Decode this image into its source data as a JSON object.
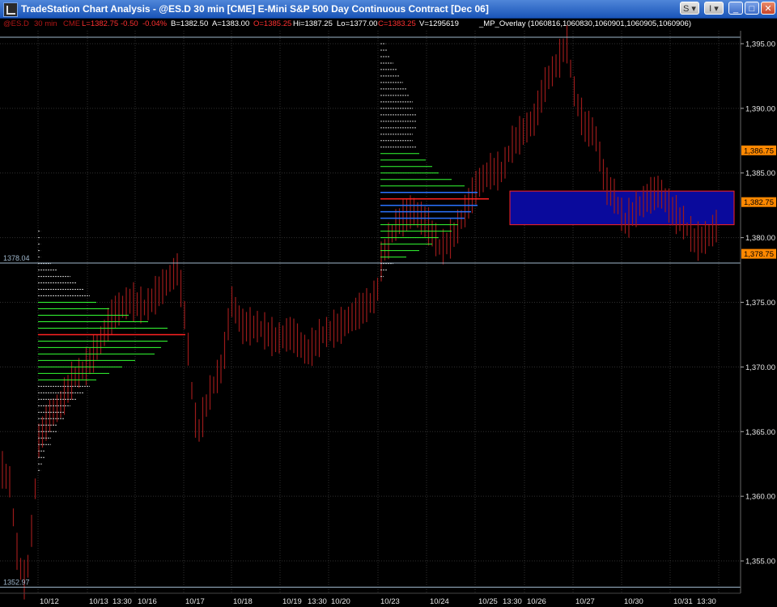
{
  "window": {
    "title": "TradeStation Chart Analysis - @ES.D  30 min  [CME] E-Mini S&P 500 Day Continuous Contract [Dec 06]",
    "buttons": {
      "s_label": "S",
      "i_label": "I"
    }
  },
  "infobar": {
    "symbol": "@ES.D",
    "interval": "30 min",
    "exchange": "CME",
    "last": "L=1382.75",
    "change": "-0.50",
    "change_pct": "-0.04%",
    "bid": "B=1382.50",
    "ask": "A=1383.00",
    "open": "O=1385.25",
    "high": "Hi=1387.25",
    "low": "Lo=1377.00",
    "close": "C=1383.25",
    "volume": "V=1295619",
    "indicator": "_MP_Overlay  (1060816,1060830,1060901,1060905,1060906)"
  },
  "colors": {
    "background": "#000000",
    "bar": "#9b1a1a",
    "profile_green": "#33ff33",
    "profile_gray": "#c8c8c8",
    "profile_blue": "#2a73ff",
    "value_box": "#0a0a9c",
    "price_tag": "#ff8800",
    "poc_red": "#ff2222",
    "hline": "#9fb7cc",
    "grid": "#303030"
  },
  "chart_data": {
    "type": "bar",
    "yaxis": {
      "min": 1352.5,
      "max": 1396,
      "ticks": [
        1395,
        1390,
        1385,
        1380,
        1375,
        1370,
        1365,
        1360,
        1355
      ]
    },
    "tick_labels": [
      "1,395.00",
      "1,390.00",
      "1,385.00",
      "1,380.00",
      "1,375.00",
      "1,370.00",
      "1,365.00",
      "1,360.00",
      "1,355.00"
    ],
    "xlabels": [
      "10/12",
      "10/13",
      "13:30",
      "10/16",
      "10/17",
      "10/18",
      "10/19",
      "13:30",
      "10/20",
      "10/23",
      "10/24",
      "10/25",
      "13:30",
      "10/26",
      "10/27",
      "10/30",
      "10/31",
      "13:30"
    ],
    "price_tags": [
      {
        "value": 1386.75,
        "label": "1,386.75"
      },
      {
        "value": 1382.75,
        "label": "1,382.75"
      },
      {
        "value": 1378.75,
        "label": "1,378.75"
      }
    ],
    "hlines": [
      {
        "value": 1378.04,
        "label": "1378.04"
      },
      {
        "value": 1352.97,
        "label": "1352.97"
      },
      {
        "value": 1395.5,
        "label": ""
      }
    ],
    "value_area": {
      "low": 1381.0,
      "high": 1383.6
    },
    "profiles": [
      {
        "levels": [
          [
            1380.5,
            0.4,
            "g"
          ],
          [
            1380.0,
            0.4,
            "g"
          ],
          [
            1379.5,
            0.4,
            "g"
          ],
          [
            1379.0,
            0.4,
            "g"
          ],
          [
            1378.5,
            0.4,
            "g"
          ],
          [
            1378.0,
            2,
            "g"
          ],
          [
            1377.5,
            3,
            "g"
          ],
          [
            1377.0,
            5,
            "g"
          ],
          [
            1376.5,
            6,
            "g"
          ],
          [
            1376.0,
            7,
            "g"
          ],
          [
            1375.5,
            8,
            "g"
          ],
          [
            1375.0,
            9,
            "G"
          ],
          [
            1374.5,
            11,
            "G"
          ],
          [
            1374.0,
            14,
            "G"
          ],
          [
            1373.5,
            17,
            "G"
          ],
          [
            1373.0,
            20,
            "G"
          ],
          [
            1372.5,
            22,
            "P"
          ],
          [
            1372.0,
            20,
            "G"
          ],
          [
            1371.5,
            19,
            "G"
          ],
          [
            1371.0,
            18,
            "G"
          ],
          [
            1370.5,
            15,
            "G"
          ],
          [
            1370.0,
            13,
            "G"
          ],
          [
            1369.5,
            11,
            "G"
          ],
          [
            1369.0,
            9,
            "G"
          ],
          [
            1368.5,
            8,
            "g"
          ],
          [
            1368.0,
            7,
            "g"
          ],
          [
            1367.5,
            6,
            "g"
          ],
          [
            1367.0,
            5,
            "g"
          ],
          [
            1366.5,
            4,
            "g"
          ],
          [
            1366.0,
            4,
            "g"
          ],
          [
            1365.5,
            3,
            "g"
          ],
          [
            1365.0,
            3,
            "g"
          ],
          [
            1364.5,
            2,
            "g"
          ],
          [
            1364.0,
            2,
            "g"
          ],
          [
            1363.5,
            1,
            "g"
          ],
          [
            1363.0,
            1,
            "g"
          ],
          [
            1362.5,
            0.6,
            "g"
          ],
          [
            1362.0,
            0.4,
            "g"
          ]
        ]
      },
      {
        "levels": [
          [
            1395.0,
            0.8,
            "g"
          ],
          [
            1394.5,
            1,
            "g"
          ],
          [
            1394.0,
            1.5,
            "g"
          ],
          [
            1393.5,
            2,
            "g"
          ],
          [
            1393.0,
            2.5,
            "g"
          ],
          [
            1392.5,
            3,
            "g"
          ],
          [
            1392.0,
            3.5,
            "g"
          ],
          [
            1391.5,
            4,
            "g"
          ],
          [
            1391.0,
            4.5,
            "g"
          ],
          [
            1390.5,
            5,
            "g"
          ],
          [
            1390.0,
            5,
            "g"
          ],
          [
            1389.5,
            5.5,
            "g"
          ],
          [
            1389.0,
            5.5,
            "g"
          ],
          [
            1388.5,
            5.5,
            "g"
          ],
          [
            1388.0,
            5,
            "g"
          ],
          [
            1387.5,
            5,
            "g"
          ],
          [
            1387.0,
            5.5,
            "g"
          ],
          [
            1386.5,
            6,
            "G"
          ],
          [
            1386.0,
            7,
            "G"
          ],
          [
            1385.5,
            8,
            "G"
          ],
          [
            1385.0,
            9,
            "G"
          ],
          [
            1384.5,
            11,
            "G"
          ],
          [
            1384.0,
            13,
            "G"
          ],
          [
            1383.5,
            15,
            "B"
          ],
          [
            1383.0,
            16,
            "P"
          ],
          [
            1382.5,
            15,
            "B"
          ],
          [
            1382.0,
            14,
            "B"
          ],
          [
            1381.5,
            13,
            "B"
          ],
          [
            1381.0,
            12,
            "G"
          ],
          [
            1380.5,
            11,
            "G"
          ],
          [
            1380.0,
            9,
            "G"
          ],
          [
            1379.5,
            8,
            "G"
          ],
          [
            1379.0,
            6,
            "G"
          ],
          [
            1378.5,
            4,
            "G"
          ],
          [
            1378.0,
            2,
            "g"
          ],
          [
            1377.5,
            1,
            "g"
          ],
          [
            1377.0,
            0.5,
            "g"
          ]
        ]
      }
    ]
  }
}
